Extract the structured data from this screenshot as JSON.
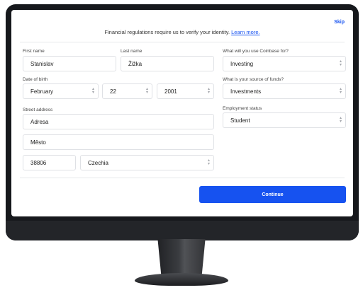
{
  "header": {
    "skip_label": "Skip",
    "notice_text": "Financial regulations require us to verify your identity.",
    "learn_more_label": "Learn more."
  },
  "personal": {
    "first_name_label": "First name",
    "first_name_value": "Stanislav",
    "last_name_label": "Last name",
    "last_name_value": "Žižka",
    "dob_label": "Date of birth",
    "dob_month": "February",
    "dob_day": "22",
    "dob_year": "2001"
  },
  "address": {
    "label": "Street address",
    "street_value": "Adresa",
    "city_value": "Město",
    "zip_value": "38806",
    "country_value": "Czechia"
  },
  "usage": {
    "use_label": "What will you use Coinbase for?",
    "use_value": "Investing",
    "funds_label": "What is your source of funds?",
    "funds_value": "Investments",
    "employment_label": "Employment status",
    "employment_value": "Student"
  },
  "actions": {
    "continue_label": "Continue"
  },
  "colors": {
    "accent": "#1652f0",
    "bezel": "#16181c"
  }
}
